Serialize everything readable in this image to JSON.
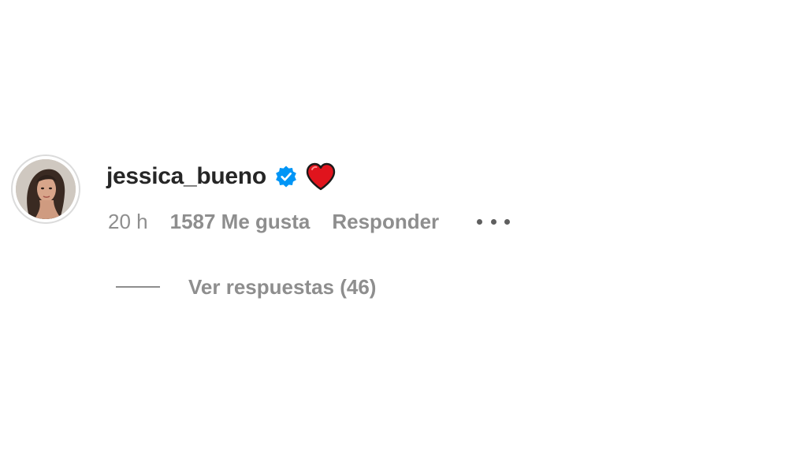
{
  "comment": {
    "author": {
      "username": "jessica_bueno",
      "verified": true,
      "avatar_icon": "profile-photo-woman",
      "verified_icon": "verified-badge-icon",
      "verified_color": "#0095f6"
    },
    "emoji": "heart-red",
    "emoji_color": "#e0141d",
    "time": "20 h",
    "likes": "1587 Me gusta",
    "reply_label": "Responder",
    "more_icon": "more-options-icon",
    "view_replies_label": "Ver respuestas (46)"
  },
  "colors": {
    "text_primary": "#262626",
    "text_secondary": "#8e8e8e",
    "avatar_border": "#dbdbdb"
  }
}
